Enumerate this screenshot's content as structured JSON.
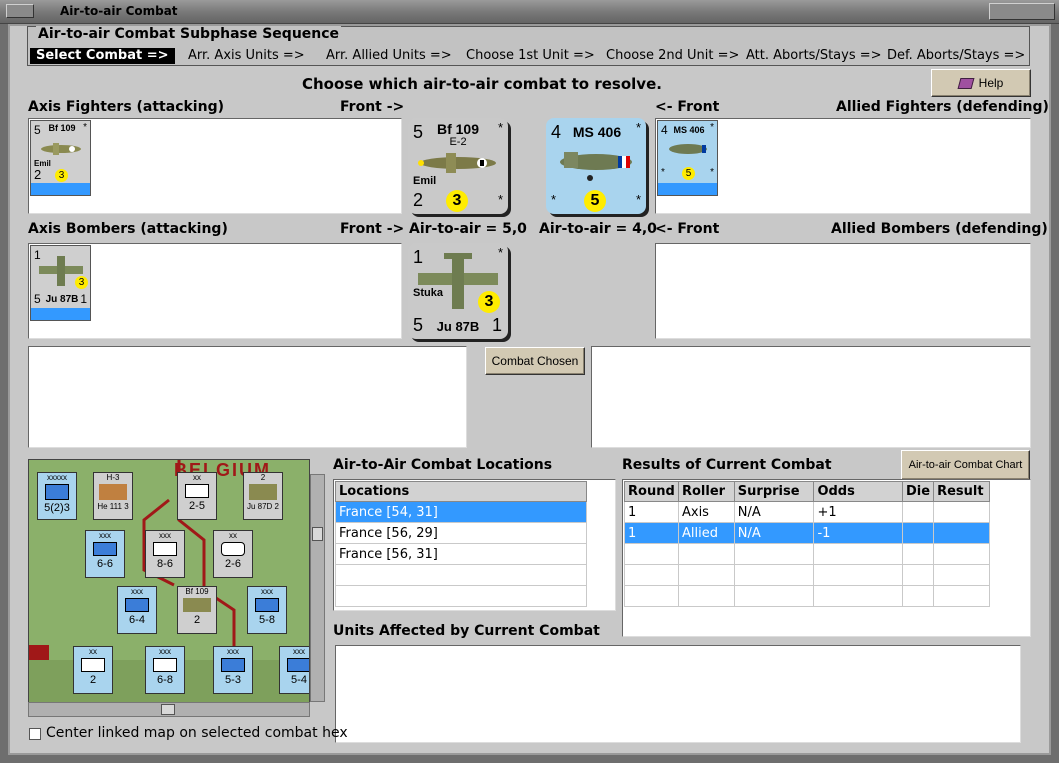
{
  "window": {
    "title": "Air-to-air Combat"
  },
  "header": {
    "title": "Air-to-air Combat Subphase Sequence",
    "steps": [
      "Select Combat =>",
      "Arr. Axis Units =>",
      "Arr. Allied Units =>",
      "Choose 1st Unit =>",
      "Choose 2nd Unit =>",
      "Att. Aborts/Stays =>",
      "Def. Aborts/Stays =>"
    ]
  },
  "prompt": "Choose which air-to-air combat to resolve.",
  "help_button": "Help",
  "labels": {
    "axis_fighters": "Axis Fighters (attacking)",
    "front_right": "Front ->",
    "front_left": "<- Front",
    "allied_fighters": "Allied Fighters (defending)",
    "axis_bombers": "Axis Bombers (attacking)",
    "front_right2": "Front ->",
    "axis_air_to_air": "Air-to-air = 5,0",
    "allied_air_to_air": "Air-to-air = 4,0",
    "front_left2": "<- Front",
    "allied_bombers": "Allied Bombers (defending)"
  },
  "units": {
    "bf109": {
      "top": "5",
      "name": "Bf 109",
      "variant": "E-2",
      "nick": "Emil",
      "bottom": "2",
      "star": "*",
      "die": "3"
    },
    "ms406": {
      "top": "4",
      "name": "MS 406",
      "star": "*",
      "die": "5"
    },
    "ju87": {
      "top": "1",
      "nick": "Stuka",
      "bottom": "5",
      "name": "Ju 87B",
      "right": "1",
      "star": "*",
      "die": "3"
    }
  },
  "combat_chosen_button": "Combat Chosen",
  "locations": {
    "title": "Air-to-Air Combat Locations",
    "header": "Locations",
    "rows": [
      "France [54, 31]",
      "France [56, 29]",
      "France [56, 31]",
      "",
      ""
    ],
    "selected_index": 0
  },
  "results": {
    "title": "Results of Current Combat",
    "chart_button": "Air-to-air Combat Chart",
    "columns": [
      "Round",
      "Roller",
      "Surprise",
      "Odds",
      "Die",
      "Result"
    ],
    "rows": [
      [
        "1",
        "Axis",
        "N/A",
        "+1",
        "",
        ""
      ],
      [
        "1",
        "Allied",
        "N/A",
        "-1",
        "",
        ""
      ],
      [
        "",
        "",
        "",
        "",
        "",
        ""
      ],
      [
        "",
        "",
        "",
        "",
        "",
        ""
      ],
      [
        "",
        "",
        "",
        "",
        "",
        ""
      ]
    ],
    "selected_index": 1
  },
  "units_affected": {
    "title": "Units Affected by Current Combat"
  },
  "map": {
    "place_label": "BELGIUM",
    "units": [
      {
        "top": "xxxxx",
        "bottom": "5(2)3",
        "side": "allied"
      },
      {
        "top": "H-3",
        "bottom": "He 111  3",
        "side": "axis"
      },
      {
        "top": "xx",
        "bottom": "2-5",
        "side": "axis"
      },
      {
        "top": "2",
        "bottom": "Ju 87D  2",
        "side": "axis"
      },
      {
        "top": "xxx",
        "bottom": "6-6",
        "side": "allied"
      },
      {
        "top": "xxx",
        "bottom": "8-6",
        "side": "axis"
      },
      {
        "top": "xx",
        "bottom": "2-6",
        "side": "axis"
      },
      {
        "top": "xxx",
        "bottom": "6-4",
        "side": "allied"
      },
      {
        "top": "Bf 109",
        "bottom": "2",
        "side": "axis"
      },
      {
        "top": "xxx",
        "bottom": "5-8",
        "side": "allied"
      },
      {
        "top": "xx",
        "bottom": "2",
        "side": "allied"
      },
      {
        "top": "xxx",
        "bottom": "6-8",
        "side": "allied"
      },
      {
        "top": "xxx",
        "bottom": "5-3",
        "side": "allied"
      },
      {
        "top": "xxx",
        "bottom": "5-4",
        "side": "allied"
      }
    ]
  },
  "center_checkbox_label": "Center linked map on selected combat hex",
  "colors": {
    "selection": "#3399ff",
    "allied_counter": "#a9d4ee",
    "axis_counter": "#cfcfcf",
    "die": "#ffec00",
    "button": "#d2c9b3"
  }
}
